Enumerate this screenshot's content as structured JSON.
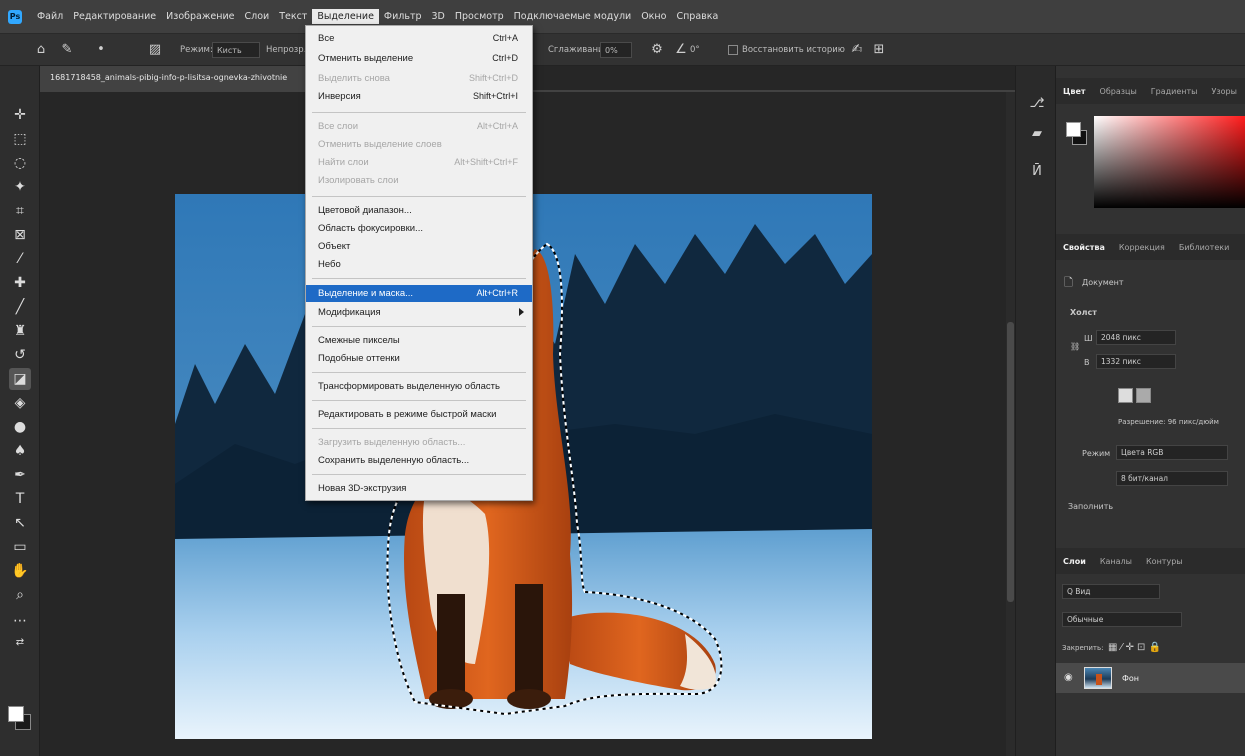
{
  "menubar": {
    "items": [
      "Файл",
      "Редактирование",
      "Изображение",
      "Слои",
      "Текст",
      "Выделение",
      "Фильтр",
      "3D",
      "Просмотр",
      "Подключаемые модули",
      "Окно",
      "Справка"
    ]
  },
  "options": {
    "mode_label": "Режим:",
    "mode_value": "Кисть",
    "opacity_label": "Непрозр.:",
    "smoothing_label": "Сглаживание:",
    "smoothing_value": "0%",
    "angle_value": "0°",
    "history_label": "Восстановить историю"
  },
  "document": {
    "tab_title": "1681718458_animals-pibig-info-p-lisitsa-ognevka-zhivotnie"
  },
  "selection_menu": {
    "items": [
      {
        "label": "Все",
        "shortcut": "Ctrl+A",
        "disabled": false
      },
      {
        "label": "Отменить выделение",
        "shortcut": "Ctrl+D",
        "disabled": false
      },
      {
        "label": "Выделить снова",
        "shortcut": "Shift+Ctrl+D",
        "disabled": true
      },
      {
        "label": "Инверсия",
        "shortcut": "Shift+Ctrl+I",
        "disabled": false
      },
      {
        "label": "Все слои",
        "shortcut": "Alt+Ctrl+A",
        "disabled": true
      },
      {
        "label": "Отменить выделение слоев",
        "shortcut": "",
        "disabled": true
      },
      {
        "label": "Найти слои",
        "shortcut": "Alt+Shift+Ctrl+F",
        "disabled": true
      },
      {
        "label": "Изолировать слои",
        "shortcut": "",
        "disabled": true
      },
      {
        "label": "Цветовой диапазон...",
        "shortcut": "",
        "disabled": false
      },
      {
        "label": "Область фокусировки...",
        "shortcut": "",
        "disabled": false
      },
      {
        "label": "Объект",
        "shortcut": "",
        "disabled": false
      },
      {
        "label": "Небо",
        "shortcut": "",
        "disabled": false
      },
      {
        "label": "Выделение и маска...",
        "shortcut": "Alt+Ctrl+R",
        "disabled": false,
        "highlighted": true
      },
      {
        "label": "Модификация",
        "shortcut": "",
        "disabled": false,
        "submenu": true
      },
      {
        "label": "Смежные пикселы",
        "shortcut": "",
        "disabled": false
      },
      {
        "label": "Подобные оттенки",
        "shortcut": "",
        "disabled": false
      },
      {
        "label": "Трансформировать выделенную область",
        "shortcut": "",
        "disabled": false
      },
      {
        "label": "Редактировать в режиме быстрой маски",
        "shortcut": "",
        "disabled": false
      },
      {
        "label": "Загрузить выделенную область...",
        "shortcut": "",
        "disabled": true
      },
      {
        "label": "Сохранить выделенную область...",
        "shortcut": "",
        "disabled": false
      },
      {
        "label": "Новая 3D-экструзия",
        "shortcut": "",
        "disabled": false
      }
    ]
  },
  "panels": {
    "color_tabs": [
      "Цвет",
      "Образцы",
      "Градиенты",
      "Узоры"
    ],
    "props_tabs": [
      "Свойства",
      "Коррекция",
      "Библиотеки"
    ],
    "doc_label": "Документ",
    "canvas_label": "Холст",
    "width_label": "Ш",
    "width_value": "2048 пикс",
    "height_label": "В",
    "height_value": "1332 пикс",
    "resolution": "Разрешение: 96 пикс/дюйм",
    "mode_label": "Режим",
    "mode_value": "Цвета RGB",
    "bits_value": "8 бит/канал",
    "fill_label": "Заполнить",
    "layers_tabs": [
      "Слои",
      "Каналы",
      "Контуры"
    ],
    "search_placeholder": "Q Вид",
    "blend_mode": "Обычные",
    "lock_label": "Закрепить:",
    "layer_name": "Фон"
  },
  "colors": {
    "accent": "#1e6ac6",
    "menubar": "#3f3f3f",
    "canvas_bg": "#262626"
  }
}
